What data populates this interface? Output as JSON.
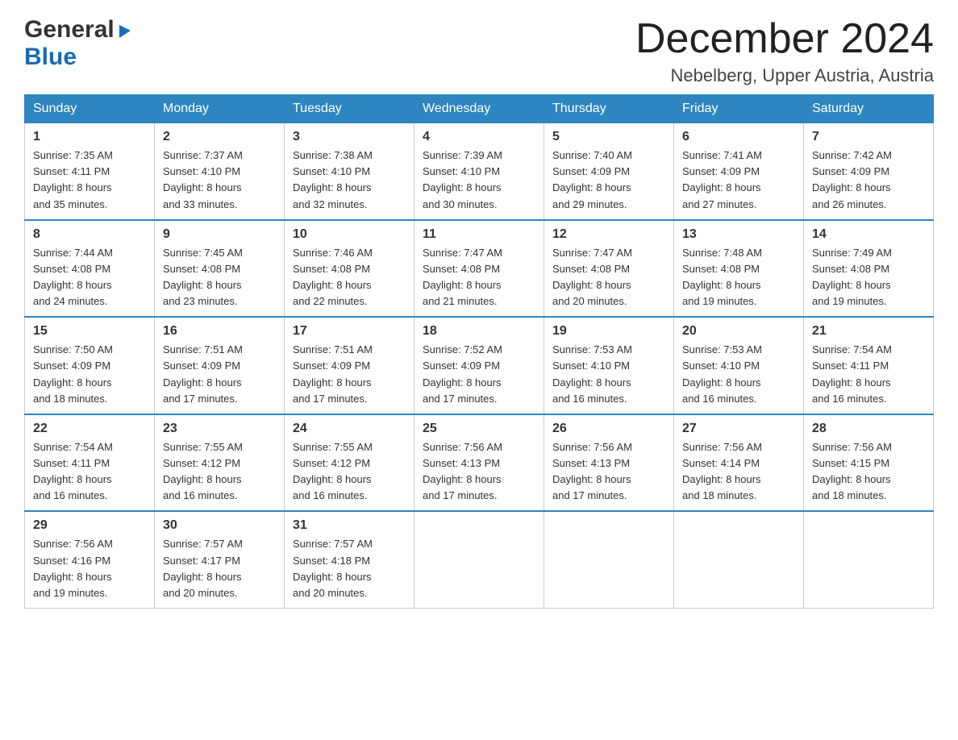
{
  "logo": {
    "general": "General",
    "blue": "Blue",
    "triangle": "▶"
  },
  "header": {
    "month_year": "December 2024",
    "location": "Nebelberg, Upper Austria, Austria"
  },
  "weekdays": [
    "Sunday",
    "Monday",
    "Tuesday",
    "Wednesday",
    "Thursday",
    "Friday",
    "Saturday"
  ],
  "weeks": [
    [
      {
        "day": "1",
        "sunrise": "7:35 AM",
        "sunset": "4:11 PM",
        "daylight": "8 hours and 35 minutes."
      },
      {
        "day": "2",
        "sunrise": "7:37 AM",
        "sunset": "4:10 PM",
        "daylight": "8 hours and 33 minutes."
      },
      {
        "day": "3",
        "sunrise": "7:38 AM",
        "sunset": "4:10 PM",
        "daylight": "8 hours and 32 minutes."
      },
      {
        "day": "4",
        "sunrise": "7:39 AM",
        "sunset": "4:10 PM",
        "daylight": "8 hours and 30 minutes."
      },
      {
        "day": "5",
        "sunrise": "7:40 AM",
        "sunset": "4:09 PM",
        "daylight": "8 hours and 29 minutes."
      },
      {
        "day": "6",
        "sunrise": "7:41 AM",
        "sunset": "4:09 PM",
        "daylight": "8 hours and 27 minutes."
      },
      {
        "day": "7",
        "sunrise": "7:42 AM",
        "sunset": "4:09 PM",
        "daylight": "8 hours and 26 minutes."
      }
    ],
    [
      {
        "day": "8",
        "sunrise": "7:44 AM",
        "sunset": "4:08 PM",
        "daylight": "8 hours and 24 minutes."
      },
      {
        "day": "9",
        "sunrise": "7:45 AM",
        "sunset": "4:08 PM",
        "daylight": "8 hours and 23 minutes."
      },
      {
        "day": "10",
        "sunrise": "7:46 AM",
        "sunset": "4:08 PM",
        "daylight": "8 hours and 22 minutes."
      },
      {
        "day": "11",
        "sunrise": "7:47 AM",
        "sunset": "4:08 PM",
        "daylight": "8 hours and 21 minutes."
      },
      {
        "day": "12",
        "sunrise": "7:47 AM",
        "sunset": "4:08 PM",
        "daylight": "8 hours and 20 minutes."
      },
      {
        "day": "13",
        "sunrise": "7:48 AM",
        "sunset": "4:08 PM",
        "daylight": "8 hours and 19 minutes."
      },
      {
        "day": "14",
        "sunrise": "7:49 AM",
        "sunset": "4:08 PM",
        "daylight": "8 hours and 19 minutes."
      }
    ],
    [
      {
        "day": "15",
        "sunrise": "7:50 AM",
        "sunset": "4:09 PM",
        "daylight": "8 hours and 18 minutes."
      },
      {
        "day": "16",
        "sunrise": "7:51 AM",
        "sunset": "4:09 PM",
        "daylight": "8 hours and 17 minutes."
      },
      {
        "day": "17",
        "sunrise": "7:51 AM",
        "sunset": "4:09 PM",
        "daylight": "8 hours and 17 minutes."
      },
      {
        "day": "18",
        "sunrise": "7:52 AM",
        "sunset": "4:09 PM",
        "daylight": "8 hours and 17 minutes."
      },
      {
        "day": "19",
        "sunrise": "7:53 AM",
        "sunset": "4:10 PM",
        "daylight": "8 hours and 16 minutes."
      },
      {
        "day": "20",
        "sunrise": "7:53 AM",
        "sunset": "4:10 PM",
        "daylight": "8 hours and 16 minutes."
      },
      {
        "day": "21",
        "sunrise": "7:54 AM",
        "sunset": "4:11 PM",
        "daylight": "8 hours and 16 minutes."
      }
    ],
    [
      {
        "day": "22",
        "sunrise": "7:54 AM",
        "sunset": "4:11 PM",
        "daylight": "8 hours and 16 minutes."
      },
      {
        "day": "23",
        "sunrise": "7:55 AM",
        "sunset": "4:12 PM",
        "daylight": "8 hours and 16 minutes."
      },
      {
        "day": "24",
        "sunrise": "7:55 AM",
        "sunset": "4:12 PM",
        "daylight": "8 hours and 16 minutes."
      },
      {
        "day": "25",
        "sunrise": "7:56 AM",
        "sunset": "4:13 PM",
        "daylight": "8 hours and 17 minutes."
      },
      {
        "day": "26",
        "sunrise": "7:56 AM",
        "sunset": "4:13 PM",
        "daylight": "8 hours and 17 minutes."
      },
      {
        "day": "27",
        "sunrise": "7:56 AM",
        "sunset": "4:14 PM",
        "daylight": "8 hours and 18 minutes."
      },
      {
        "day": "28",
        "sunrise": "7:56 AM",
        "sunset": "4:15 PM",
        "daylight": "8 hours and 18 minutes."
      }
    ],
    [
      {
        "day": "29",
        "sunrise": "7:56 AM",
        "sunset": "4:16 PM",
        "daylight": "8 hours and 19 minutes."
      },
      {
        "day": "30",
        "sunrise": "7:57 AM",
        "sunset": "4:17 PM",
        "daylight": "8 hours and 20 minutes."
      },
      {
        "day": "31",
        "sunrise": "7:57 AM",
        "sunset": "4:18 PM",
        "daylight": "8 hours and 20 minutes."
      },
      null,
      null,
      null,
      null
    ]
  ],
  "labels": {
    "sunrise": "Sunrise: ",
    "sunset": "Sunset: ",
    "daylight": "Daylight: "
  }
}
